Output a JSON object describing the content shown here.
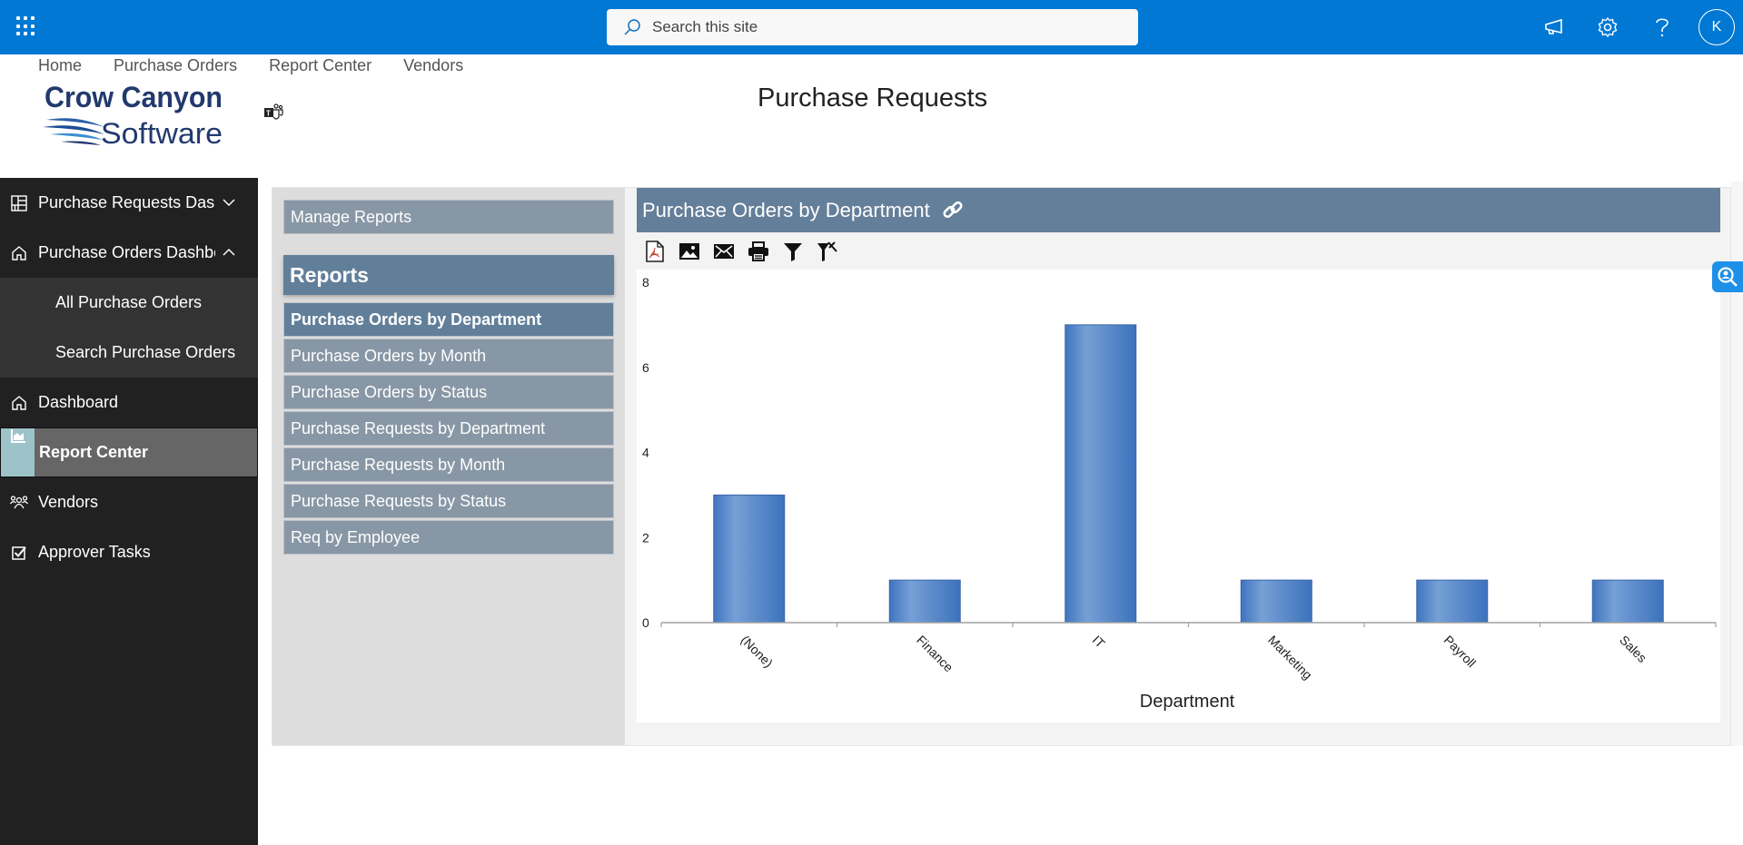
{
  "suite_bar": {
    "search_placeholder": "Search this site",
    "avatar_initial": "K",
    "icons": [
      "app-launcher-icon",
      "megaphone-icon",
      "gear-icon",
      "help-icon"
    ],
    "brand_color": "#0078d4"
  },
  "top_nav": {
    "links": [
      "Home",
      "Purchase Orders",
      "Report Center",
      "Vendors"
    ]
  },
  "logo": {
    "line1": "Crow Canyon",
    "line2": "Software"
  },
  "page_title": "Purchase Requests",
  "sidebar": {
    "items": [
      {
        "label": "Purchase Requests Dashboard",
        "icon": "dashboard-grid-icon",
        "chevron": "down"
      },
      {
        "label": "Purchase Orders Dashboard",
        "icon": "home-icon",
        "chevron": "up"
      },
      {
        "label": "All Purchase Orders",
        "sub": true
      },
      {
        "label": "Search Purchase Orders",
        "sub": true
      },
      {
        "label": "Dashboard",
        "icon": "home-icon"
      },
      {
        "label": "Report Center",
        "icon": "report-chart-icon",
        "active": true
      },
      {
        "label": "Vendors",
        "icon": "people-icon"
      },
      {
        "label": "Approver Tasks",
        "icon": "checkbox-icon"
      }
    ]
  },
  "reports_panel": {
    "manage_label": "Manage Reports",
    "header": "Reports",
    "items": [
      "Purchase Orders by Department",
      "Purchase Orders by Month",
      "Purchase Orders by Status",
      "Purchase Requests by Department",
      "Purchase Requests by Month",
      "Purchase Requests by Status",
      "Req by Employee"
    ],
    "selected_index": 0
  },
  "report_view": {
    "title": "Purchase Orders by Department",
    "toolbar": [
      "pdf-export-icon",
      "image-export-icon",
      "email-icon",
      "print-icon",
      "filter-icon",
      "clear-filter-icon"
    ]
  },
  "chart_data": {
    "type": "bar",
    "title": "",
    "xlabel": "Department",
    "ylabel": "",
    "categories": [
      "(None)",
      "Finance",
      "IT",
      "Marketing",
      "Payroll",
      "Sales"
    ],
    "values": [
      3,
      1,
      7,
      1,
      1,
      1
    ],
    "ylim": [
      0,
      8
    ],
    "yticks": [
      0,
      2,
      4,
      6,
      8
    ],
    "grid": false,
    "bar_color": "#4a7fc4"
  }
}
